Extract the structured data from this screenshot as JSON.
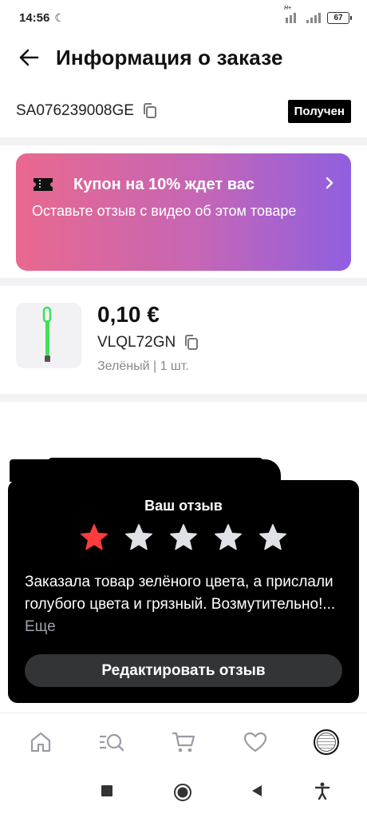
{
  "status_bar": {
    "time": "14:56",
    "battery": "67",
    "network": "H+"
  },
  "header": {
    "title": "Информация о заказе"
  },
  "order": {
    "number": "SA076239008GE",
    "status": "Получен"
  },
  "coupon": {
    "title": "Купон на 10% ждет вас",
    "subtitle": "Оставьте отзыв с видео об этом товаре"
  },
  "product": {
    "price": "0,10 €",
    "sku": "VLQL72GN",
    "variant": "Зелёный | 1 шт."
  },
  "review": {
    "title": "Ваш отзыв",
    "rating": 1,
    "max_rating": 5,
    "text": "Заказала товар зелёного цвета, а прислали голубого цвета и грязный. Возмутительно!...",
    "more_label": "Еще",
    "edit_label": "Редактировать отзыв"
  },
  "bottom_nav": {
    "items": [
      "home-icon",
      "catalog-search-icon",
      "cart-icon",
      "favorites-icon",
      "profile-avatar"
    ]
  },
  "colors": {
    "star_active": "#ff3b3b",
    "star_inactive": "#e0e1e6",
    "badge_bg": "#000000"
  }
}
